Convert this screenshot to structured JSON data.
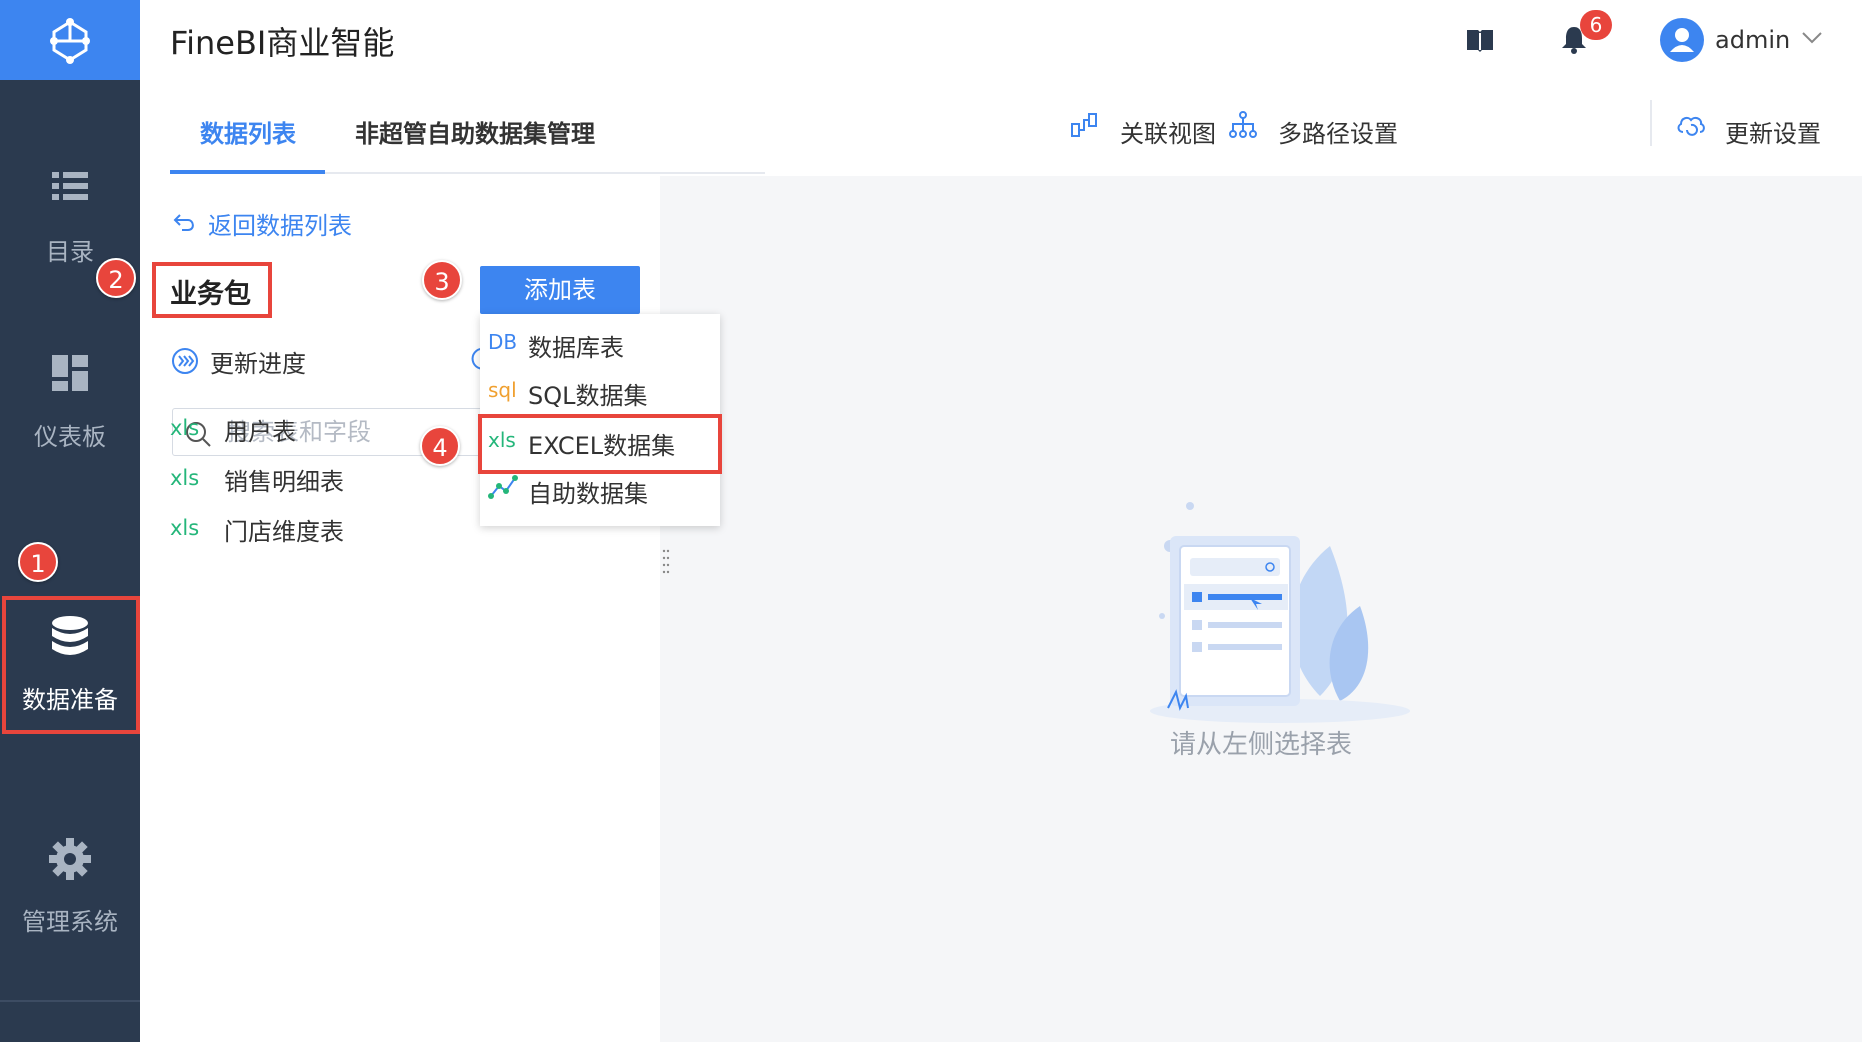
{
  "app": {
    "title": "FineBI商业智能"
  },
  "header": {
    "notification_count": "6",
    "user_name": "admin"
  },
  "nav": {
    "items": [
      {
        "label": "目录",
        "icon": "list-icon"
      },
      {
        "label": "仪表板",
        "icon": "dashboard-icon"
      },
      {
        "label": "数据准备",
        "icon": "database-icon",
        "active": true
      },
      {
        "label": "管理系统",
        "icon": "gear-icon"
      }
    ]
  },
  "tabs": [
    {
      "label": "数据列表",
      "active": true
    },
    {
      "label": "非超管自助数据集管理"
    }
  ],
  "toolbar": {
    "relation_view": "关联视图",
    "multipath": "多路径设置",
    "update_settings": "更新设置"
  },
  "panel": {
    "back_label": "返回数据列表",
    "package_title": "业务包",
    "update_progress": "更新进度",
    "search_placeholder": "搜索表和字段",
    "add_table_label": "添加表",
    "tables": [
      {
        "icon_text": "xls",
        "label": "用户表"
      },
      {
        "icon_text": "xls",
        "label": "销售明细表"
      },
      {
        "icon_text": "xls",
        "label": "门店维度表"
      }
    ]
  },
  "dropdown": {
    "items": [
      {
        "icon_text": "DB",
        "label": "数据库表",
        "color": "#3d85f0"
      },
      {
        "icon_text": "sql",
        "label": "SQL数据集",
        "color": "#f0a030"
      },
      {
        "icon_text": "xls",
        "label": "EXCEL数据集",
        "color": "#24b67a"
      },
      {
        "icon_text": "",
        "label": "自助数据集",
        "color": "#3d85f0"
      }
    ]
  },
  "empty_state": {
    "text": "请从左侧选择表"
  },
  "markers": [
    "1",
    "2",
    "3",
    "4"
  ],
  "colors": {
    "accent": "#3d85f0",
    "nav_bg": "#2b3a4f",
    "highlight": "#e8453c",
    "excel_green": "#24b67a"
  }
}
